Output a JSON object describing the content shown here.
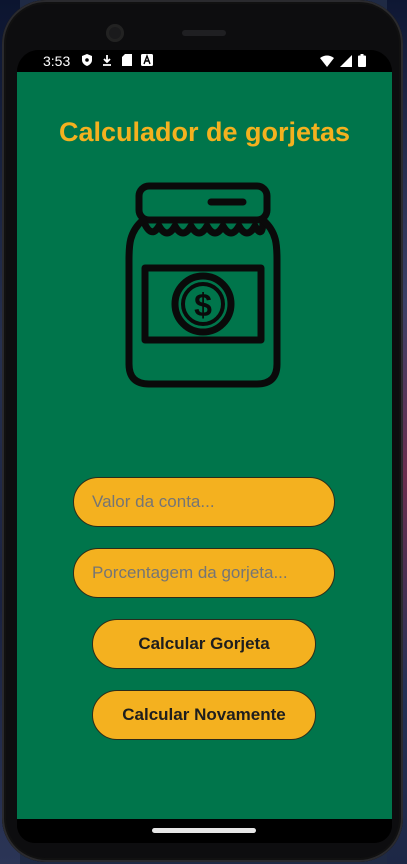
{
  "status": {
    "time": "3:53"
  },
  "app": {
    "title": "Calculador de gorjetas",
    "bill_input": {
      "placeholder": "Valor da conta...",
      "value": ""
    },
    "tip_input": {
      "placeholder": "Porcentagem da gorjeta...",
      "value": ""
    },
    "calculate_button": "Calcular Gorjeta",
    "reset_button": "Calcular Novamente"
  },
  "icons": [
    "shield-icon",
    "download-icon",
    "sd-card-icon",
    "a-icon",
    "wifi-icon",
    "signal-icon",
    "battery-icon",
    "tip-jar-icon"
  ],
  "colors": {
    "background": "#00754b",
    "accent": "#f4b11f"
  }
}
